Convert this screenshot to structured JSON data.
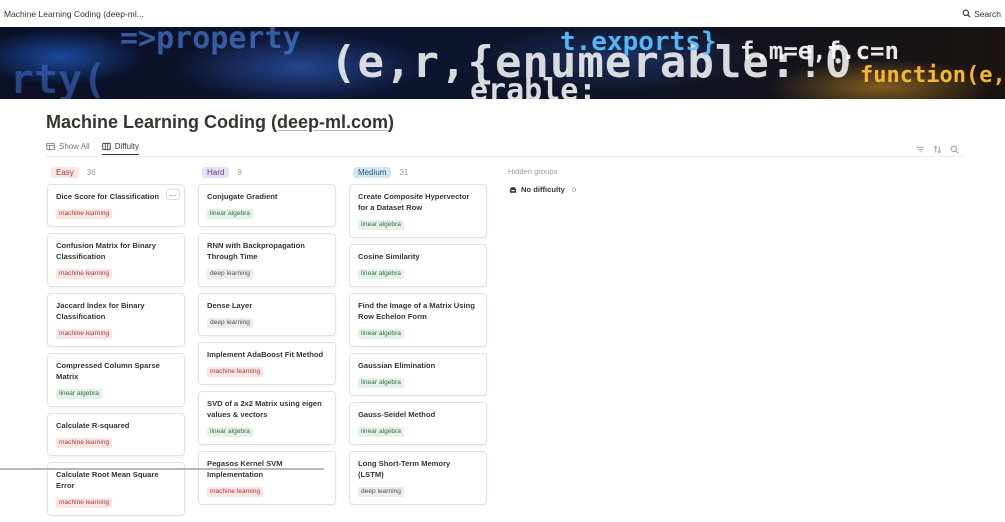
{
  "breadcrumb": "Machine Learning Coding (deep-ml...",
  "search_label": "Search",
  "page": {
    "title_prefix": "Machine Learning Coding (",
    "title_link": "deep-ml.com",
    "title_suffix": ")"
  },
  "views": [
    {
      "label": "Show All",
      "icon": "table-icon",
      "active": false
    },
    {
      "label": "Diffulty",
      "icon": "board-icon",
      "active": true
    }
  ],
  "colors": {
    "easy": "#fbe4e4",
    "hard": "#eadff5",
    "medium": "#d3e5ef",
    "tag_machine_learning": "#fbe4e4",
    "tag_linear_algebra": "#e3f1e6",
    "tag_deep_learning": "#ececeb"
  },
  "columns": [
    {
      "label": "Easy",
      "count": "36",
      "cards": [
        {
          "title": "Dice Score for Classification",
          "tag": "machine learning"
        },
        {
          "title": "Confusion Matrix for Binary Classification",
          "tag": "machine learning"
        },
        {
          "title": "Jaccard Index for Binary Classification",
          "tag": "machine learning"
        },
        {
          "title": "Compressed Column Sparse Matrix",
          "tag": "linear algebra"
        },
        {
          "title": "Calculate R-squared",
          "tag": "machine learning"
        },
        {
          "title": "Calculate Root Mean Square Error",
          "tag": "machine learning"
        }
      ]
    },
    {
      "label": "Hard",
      "count": "9",
      "cards": [
        {
          "title": "Conjugate Gradient",
          "tag": "linear algebra"
        },
        {
          "title": "RNN with Backpropagation Through Time",
          "tag": "deep learning"
        },
        {
          "title": "Dense Layer",
          "tag": "deep learning"
        },
        {
          "title": "Implement AdaBoost Fit Method",
          "tag": "machine learning"
        },
        {
          "title": "SVD of a 2x2 Matrix using eigen values & vectors",
          "tag": "linear algebra"
        },
        {
          "title": "Pegasos Kernel SVM Implementation",
          "tag": "machine learning"
        }
      ]
    },
    {
      "label": "Medium",
      "count": "31",
      "cards": [
        {
          "title": "Create Composite Hypervector for a Dataset Row",
          "tag": "linear algebra"
        },
        {
          "title": "Cosine Similarity",
          "tag": "linear algebra"
        },
        {
          "title": "Find the Image of a Matrix Using Row Echelon Form",
          "tag": "linear algebra"
        },
        {
          "title": "Gaussian Elimination",
          "tag": "linear algebra"
        },
        {
          "title": "Gauss-Seidel Method",
          "tag": "linear algebra"
        },
        {
          "title": "Long Short-Term Memory (LSTM)",
          "tag": "deep learning"
        }
      ]
    }
  ],
  "hidden_groups": {
    "label": "Hidden groups",
    "items": [
      {
        "label": "No difficulty",
        "count": "0",
        "icon": "inbox-icon"
      }
    ]
  },
  "card_more_label": "..."
}
